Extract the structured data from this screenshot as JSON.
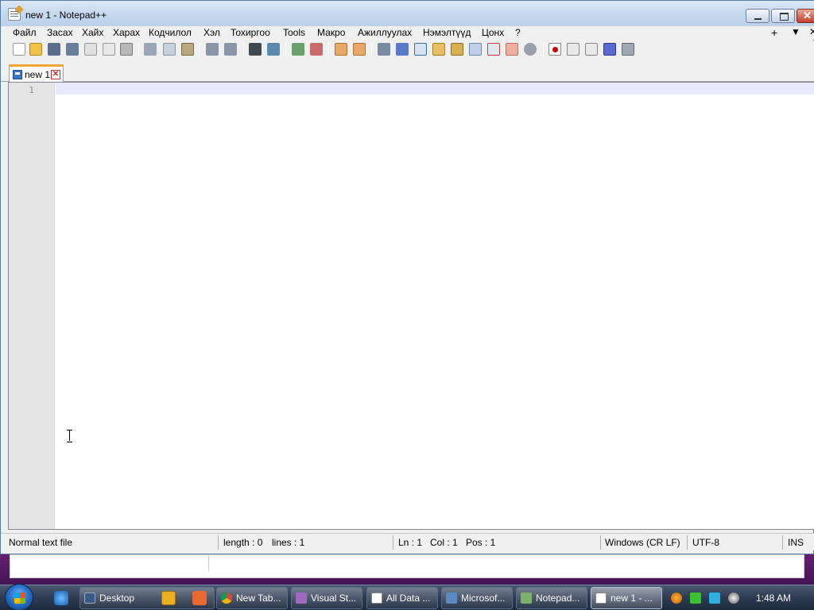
{
  "window": {
    "title": "new 1 - Notepad++"
  },
  "menu": {
    "items": [
      "Файл",
      "Засах",
      "Хайх",
      "Харах",
      "Кодчилол",
      "Хэл",
      "Тохиргоо",
      "Tools",
      "Макро",
      "Ажиллуулах",
      "Нэмэлтүүд",
      "Цонх",
      "?"
    ],
    "right": [
      "+",
      "▼",
      "✕"
    ]
  },
  "tab": {
    "label": "new 1"
  },
  "editor": {
    "line_numbers": [
      "1"
    ]
  },
  "status": {
    "file_type": "Normal text file",
    "length": "length : 0",
    "lines": "lines : 1",
    "ln": "Ln : 1",
    "col": "Col : 1",
    "pos": "Pos : 1",
    "eol": "Windows (CR LF)",
    "encoding": "UTF-8",
    "mode": "INS"
  },
  "taskbar": {
    "tasks": [
      {
        "label": "Desktop",
        "icon": "desktop-icon"
      },
      {
        "label": "New Tab...",
        "icon": "chrome-icon"
      },
      {
        "label": "Visual St...",
        "icon": "visual-studio-icon"
      },
      {
        "label": "All Data ...",
        "icon": "data-icon"
      },
      {
        "label": "Microsof...",
        "icon": "microsoft-icon"
      },
      {
        "label": "Notepad...",
        "icon": "notepad-icon"
      },
      {
        "label": "new 1 - ...",
        "icon": "notepad-plus-icon"
      }
    ],
    "clock": "1:48 AM"
  }
}
